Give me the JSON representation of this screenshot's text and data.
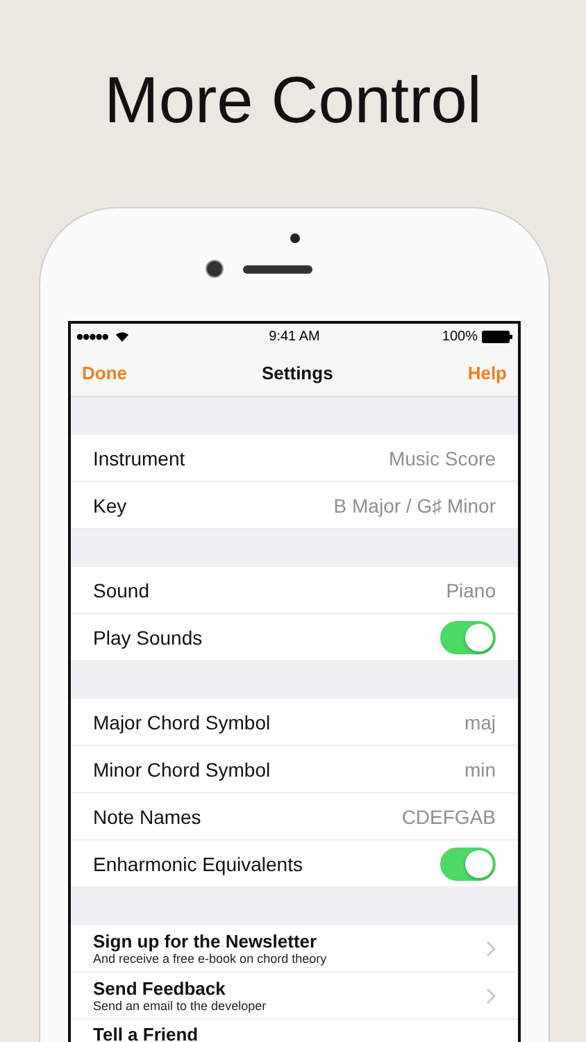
{
  "headline": "More Control",
  "status_bar": {
    "time": "9:41 AM",
    "battery": "100%"
  },
  "nav_bar": {
    "left": "Done",
    "title": "Settings",
    "right": "Help"
  },
  "sections": [
    {
      "rows": [
        {
          "kind": "value",
          "label": "Instrument",
          "value": "Music Score"
        },
        {
          "kind": "value",
          "label": "Key",
          "value": "B Major / G♯ Minor"
        }
      ]
    },
    {
      "rows": [
        {
          "kind": "value",
          "label": "Sound",
          "value": "Piano"
        },
        {
          "kind": "toggle",
          "label": "Play Sounds",
          "on": true
        }
      ]
    },
    {
      "rows": [
        {
          "kind": "value",
          "label": "Major Chord Symbol",
          "value": "maj"
        },
        {
          "kind": "value",
          "label": "Minor Chord Symbol",
          "value": "min"
        },
        {
          "kind": "value",
          "label": "Note Names",
          "value": "CDEFGAB"
        },
        {
          "kind": "toggle",
          "label": "Enharmonic Equivalents",
          "on": true
        }
      ]
    },
    {
      "rows": [
        {
          "kind": "link",
          "label": "Sign up for the Newsletter",
          "subtitle": "And receive a free e-book on chord theory"
        },
        {
          "kind": "link",
          "label": "Send Feedback",
          "subtitle": "Send an email to the developer"
        },
        {
          "kind": "link",
          "label": "Tell a Friend"
        }
      ]
    }
  ]
}
